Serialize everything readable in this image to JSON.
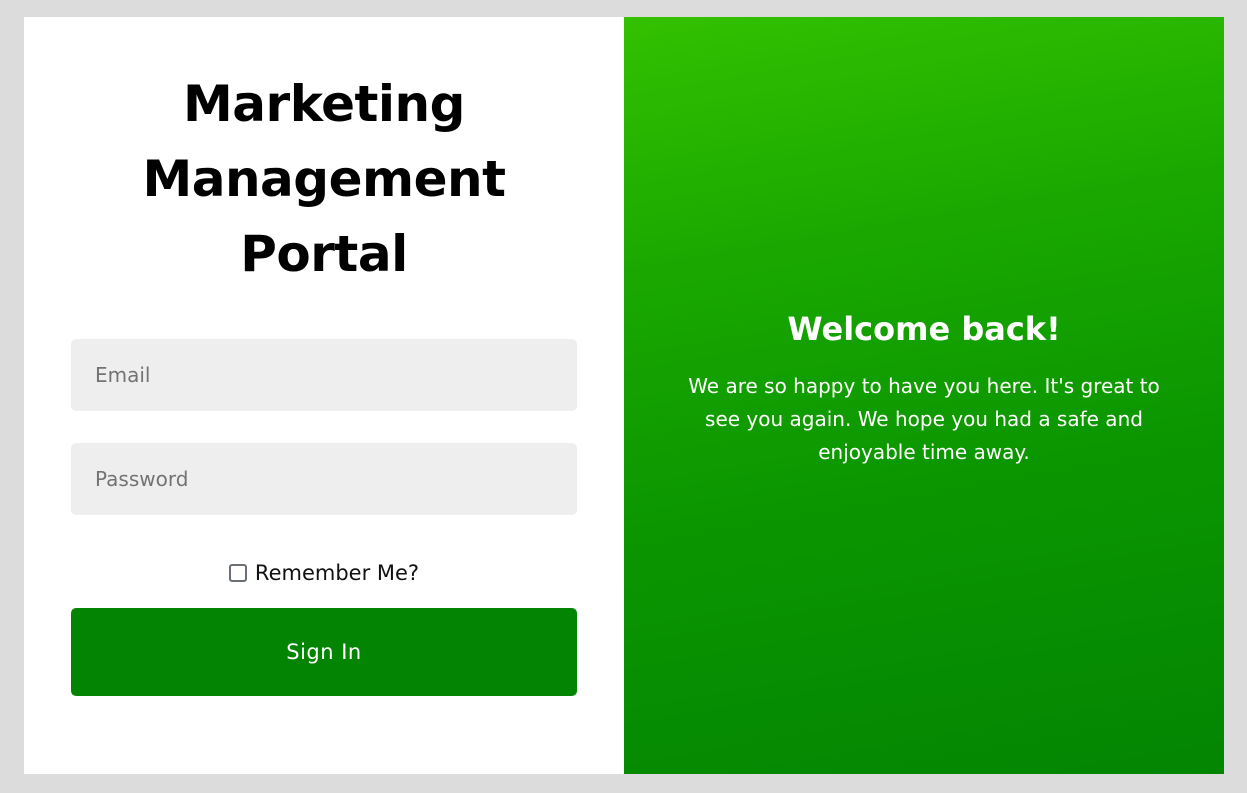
{
  "login": {
    "title_lines": [
      "Marketing",
      "Management",
      "Portal"
    ],
    "email": {
      "placeholder": "Email",
      "value": ""
    },
    "password": {
      "placeholder": "Password",
      "value": ""
    },
    "remember": {
      "label": "Remember Me?",
      "checked": false
    },
    "signin_label": "Sign In"
  },
  "welcome": {
    "title": "Welcome back!",
    "message": "We are so happy to have you here. It's great to see you again. We hope you had a safe and enjoyable time away."
  },
  "colors": {
    "page_background": "#dcdcdc",
    "accent_green": "#038503",
    "gradient_top": "#33c100",
    "input_background": "#eeeeee"
  }
}
